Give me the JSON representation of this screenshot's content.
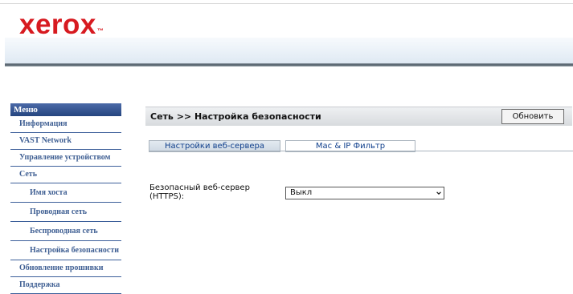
{
  "brand": {
    "logo_text": "xerox",
    "trademark": "™"
  },
  "sidebar": {
    "header": "Меню",
    "items": [
      {
        "label": "Информация",
        "level": 1
      },
      {
        "label": "VAST Network",
        "level": 1
      },
      {
        "label": "Управление устройством",
        "level": 1
      },
      {
        "label": "Сеть",
        "level": 1
      },
      {
        "label": "Имя хоста",
        "level": 2
      },
      {
        "label": "Проводная сеть",
        "level": 2
      },
      {
        "label": "Беспроводная сеть",
        "level": 2
      },
      {
        "label": "Настройка безопасности",
        "level": 2
      },
      {
        "label": "Обновление прошивки",
        "level": 1
      },
      {
        "label": "Поддержка",
        "level": 1
      }
    ]
  },
  "content": {
    "title": "Сеть >> Настройка безопасности",
    "refresh_label": "Обновить",
    "tabs": [
      {
        "label": "Настройки веб-сервера",
        "active": true
      },
      {
        "label": "Mac & IP Фильтр",
        "active": false
      }
    ],
    "form": {
      "https_label_line1": "Безопасный веб-сервер",
      "https_label_line2": "(HTTPS):",
      "https_value": "Выкл"
    }
  },
  "colors": {
    "brand_red": "#d71a20",
    "menu_text": "#3f5f93",
    "menu_header": "#25457f",
    "tab_text": "#0f3f8c"
  },
  "icons": {
    "select_arrow": "chevron-down-icon"
  }
}
